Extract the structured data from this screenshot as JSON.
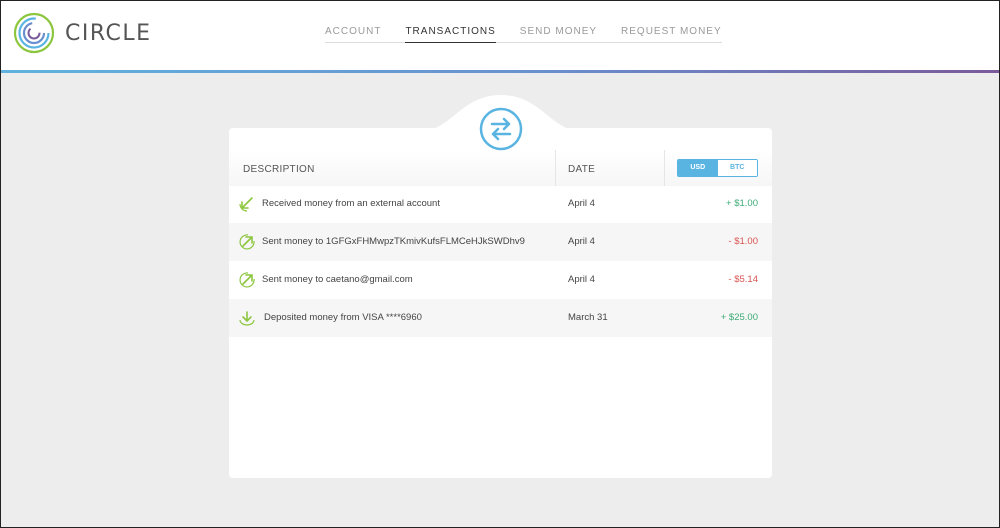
{
  "brand": {
    "name": "CIRCLE",
    "logo_icon": "circle-logo-icon"
  },
  "nav": [
    {
      "label": "ACCOUNT",
      "active": false
    },
    {
      "label": "TRANSACTIONS",
      "active": true
    },
    {
      "label": "SEND MONEY",
      "active": false
    },
    {
      "label": "REQUEST MONEY",
      "active": false
    }
  ],
  "colors": {
    "accent": "#5ab4e2",
    "positive": "#3cab75",
    "negative": "#d9534f",
    "icon_green": "#8cc63f"
  },
  "table": {
    "header_icon": "swap-arrows-icon",
    "columns": {
      "description": "DESCRIPTION",
      "date": "DATE"
    },
    "currency_toggle": {
      "usd": "USD",
      "btc": "BTC",
      "selected": "USD"
    },
    "rows": [
      {
        "icon": "received-arrow-icon",
        "description": "Received money from an external account",
        "date": "April 4",
        "amount": "+ $1.00",
        "sign": "pos"
      },
      {
        "icon": "sent-arrow-icon",
        "description": "Sent money to 1GFGxFHMwpzTKmivKufsFLMCeHJkSWDhv9",
        "date": "April 4",
        "amount": "- $1.00",
        "sign": "neg"
      },
      {
        "icon": "sent-arrow-icon",
        "description": "Sent money to caetano@gmail.com",
        "date": "April 4",
        "amount": "- $5.14",
        "sign": "neg"
      },
      {
        "icon": "deposit-arrow-icon",
        "description": "Deposited money from VISA ****6960",
        "date": "March 31",
        "amount": "+ $25.00",
        "sign": "pos"
      }
    ]
  }
}
